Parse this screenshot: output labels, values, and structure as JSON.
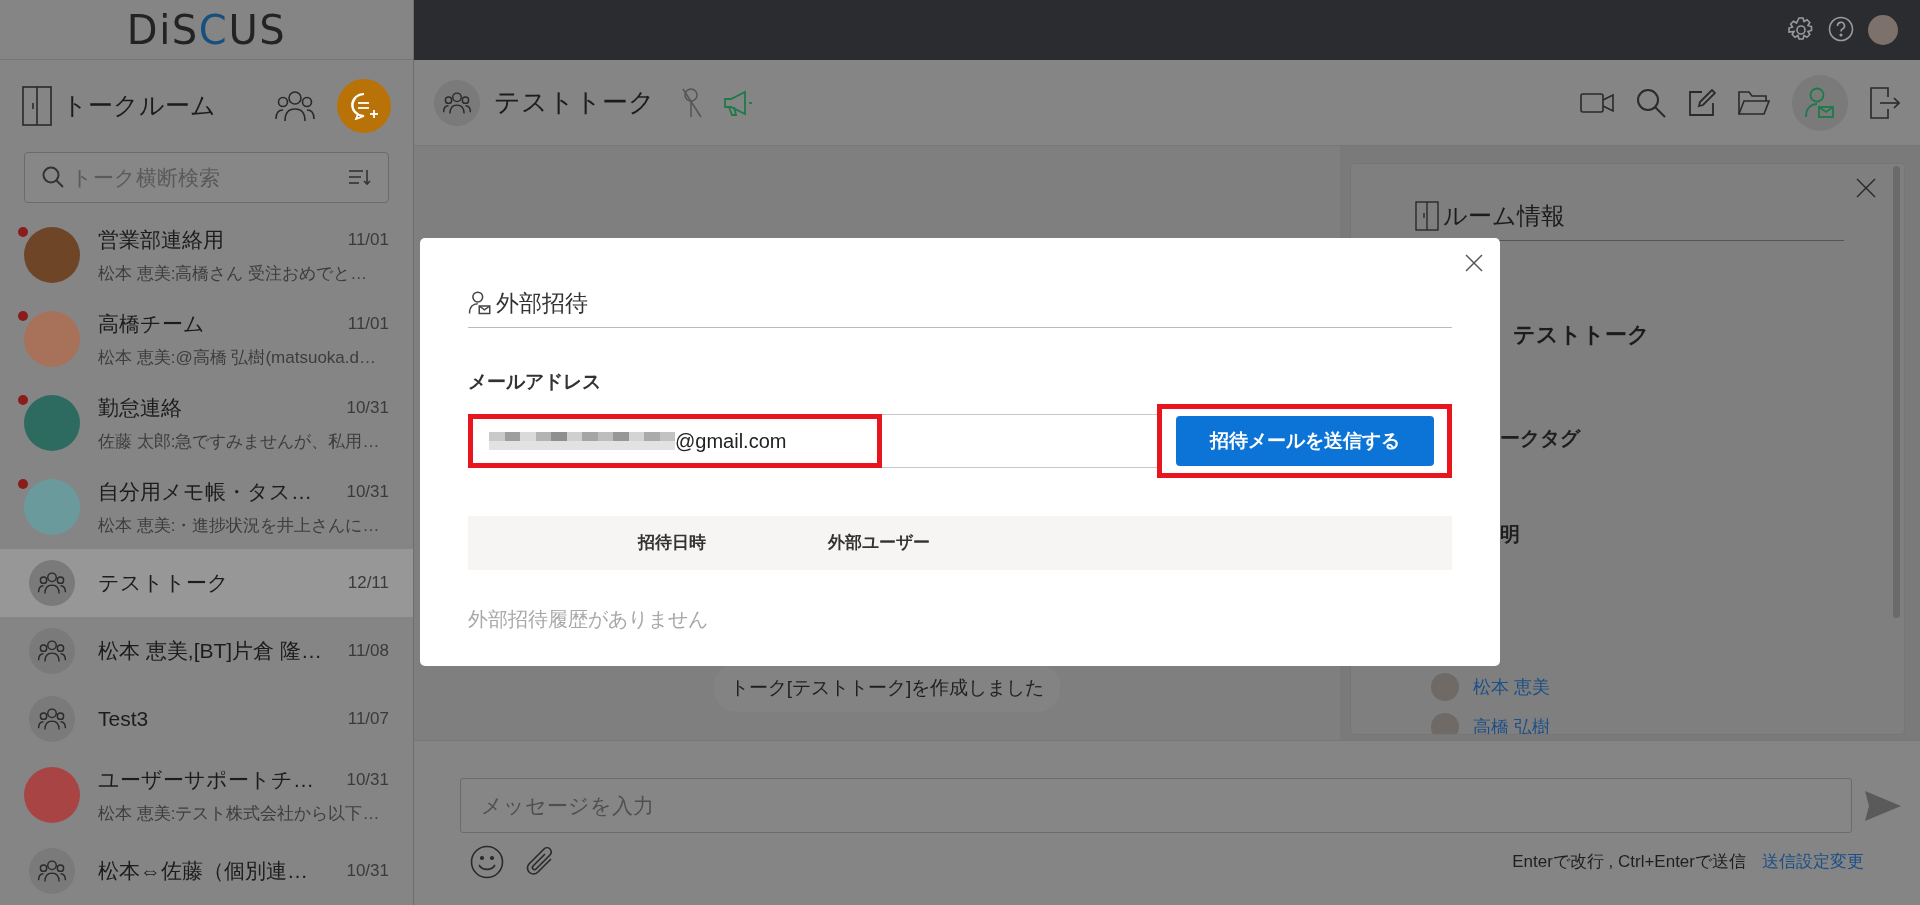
{
  "logo": {
    "text": "DiSCUS"
  },
  "sidebar": {
    "title": "トークルーム",
    "search": {
      "placeholder": "トーク横断検索"
    },
    "rooms": [
      {
        "name": "営業部連絡用",
        "date": "11/01",
        "preview": "松本 恵美:高橋さん 受注おめでと…",
        "unread": true,
        "selected": false,
        "avatar": {
          "kind": "image",
          "color": "#6e4526"
        }
      },
      {
        "name": "高橋チーム",
        "date": "11/01",
        "preview": "松本 恵美:@高橋 弘樹(matsuoka.d…",
        "unread": true,
        "selected": false,
        "avatar": {
          "kind": "image",
          "color": "#a8715a"
        }
      },
      {
        "name": "勤怠連絡",
        "date": "10/31",
        "preview": "佐藤 太郎:急ですみませんが、私用…",
        "unread": true,
        "selected": false,
        "avatar": {
          "kind": "image",
          "color": "#2d6b60"
        }
      },
      {
        "name": "自分用メモ帳・タス…",
        "date": "10/31",
        "preview": "松本 恵美:・進捗状況を井上さんに…",
        "unread": true,
        "selected": false,
        "avatar": {
          "kind": "image",
          "color": "#6b9a9c"
        }
      },
      {
        "name": "テストトーク",
        "date": "12/11",
        "unread": false,
        "selected": true,
        "avatar": {
          "kind": "group"
        }
      },
      {
        "name": "松本 恵美,[BT]片倉 隆…",
        "date": "11/08",
        "unread": false,
        "selected": false,
        "avatar": {
          "kind": "group"
        }
      },
      {
        "name": "Test3",
        "date": "11/07",
        "unread": false,
        "selected": false,
        "avatar": {
          "kind": "group"
        }
      },
      {
        "name": "ユーザーサポートチ…",
        "date": "10/31",
        "preview": "松本 恵美:テスト株式会社から以下…",
        "unread": false,
        "selected": false,
        "avatar": {
          "kind": "image",
          "color": "#a84444"
        }
      },
      {
        "name": "松本⇔佐藤（個別連…",
        "date": "10/31",
        "unread": false,
        "selected": false,
        "avatar": {
          "kind": "group"
        }
      }
    ]
  },
  "chat": {
    "title": "テストトーク",
    "messages": [
      {
        "text": "トーク[テストトーク]を作成しました"
      }
    ],
    "composer": {
      "placeholder": "メッセージを入力",
      "hint": "Enterで改行 , Ctrl+Enterで送信",
      "settings_link": "送信設定変更"
    }
  },
  "room_info": {
    "title": "ルーム情報",
    "name": "テストトーク",
    "sections": [
      "ークタグ",
      "明"
    ],
    "members": [
      "松本 恵美",
      "高橋 弘樹"
    ]
  },
  "modal": {
    "title": "外部招待",
    "email_label": "メールアドレス",
    "email": {
      "value": "@gmail.com",
      "redacted": true,
      "highlighted": true
    },
    "send_button": {
      "label": "招待メールを送信する",
      "highlighted": true
    },
    "table": {
      "columns": [
        "招待日時",
        "外部ユーザー"
      ]
    },
    "empty_message": "外部招待履歴がありません"
  }
}
